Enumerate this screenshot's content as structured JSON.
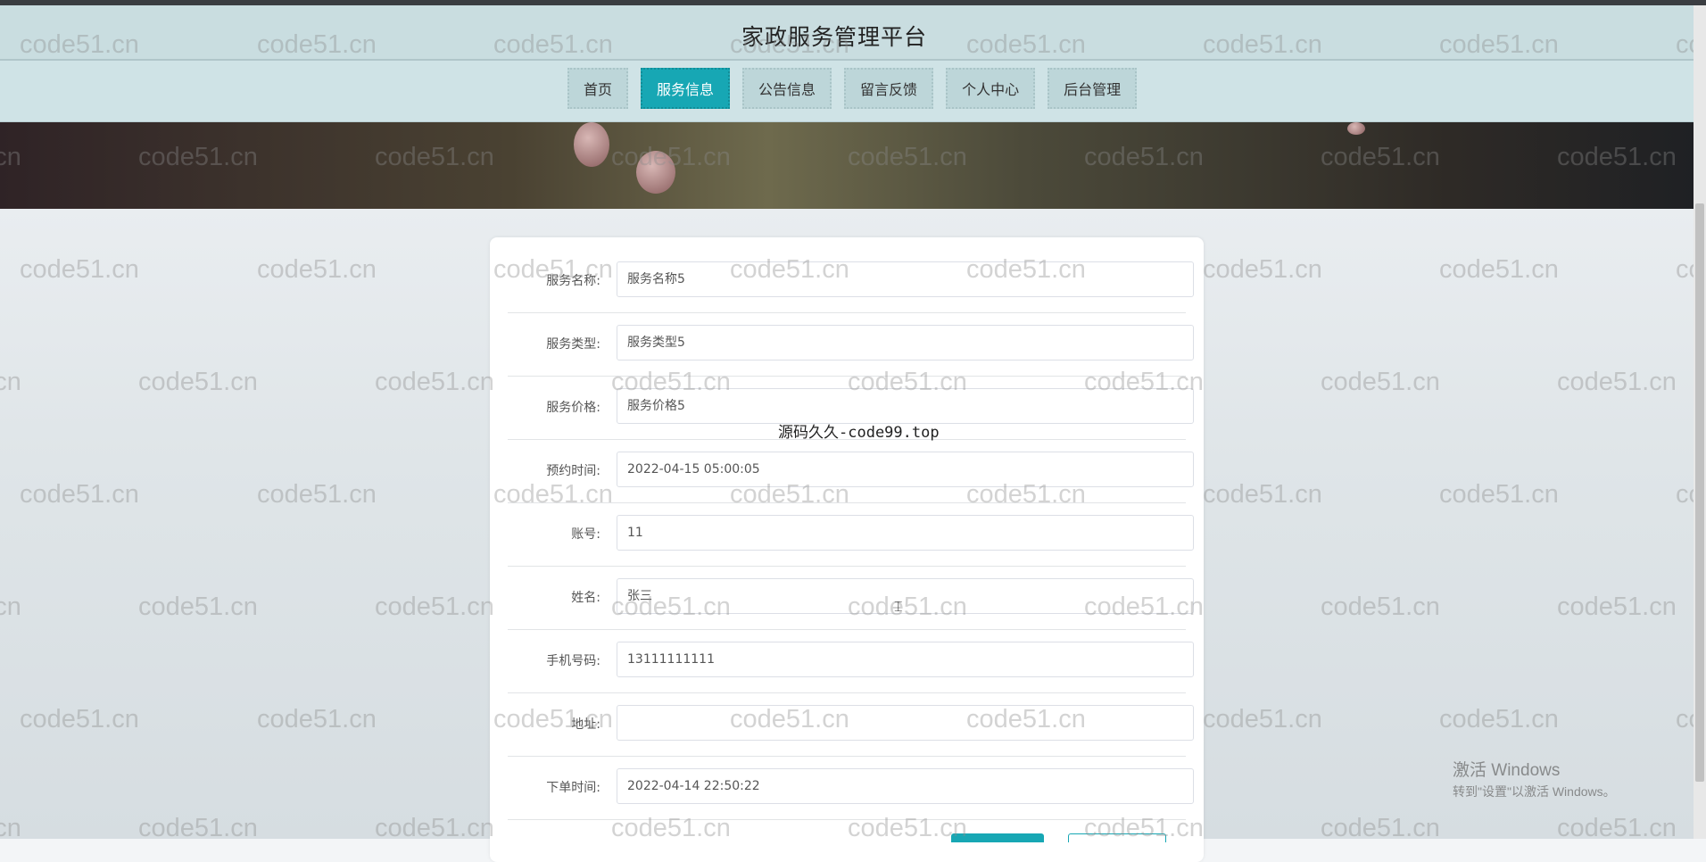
{
  "header": {
    "site_title": "家政服务管理平台"
  },
  "nav": {
    "items": [
      {
        "label": "首页",
        "active": false
      },
      {
        "label": "服务信息",
        "active": true
      },
      {
        "label": "公告信息",
        "active": false
      },
      {
        "label": "留言反馈",
        "active": false
      },
      {
        "label": "个人中心",
        "active": false
      },
      {
        "label": "后台管理",
        "active": false
      }
    ]
  },
  "form": {
    "fields": [
      {
        "label": "服务名称:",
        "value": "服务名称5"
      },
      {
        "label": "服务类型:",
        "value": "服务类型5"
      },
      {
        "label": "服务价格:",
        "value": "服务价格5"
      },
      {
        "label": "预约时间:",
        "value": "2022-04-15 05:00:05"
      },
      {
        "label": "账号:",
        "value": "11"
      },
      {
        "label": "姓名:",
        "value": "张三"
      },
      {
        "label": "手机号码:",
        "value": "13111111111"
      },
      {
        "label": "地址:",
        "value": ""
      },
      {
        "label": "下单时间:",
        "value": "2022-04-14 22:50:22"
      }
    ]
  },
  "overlay_text": "源码久久-code99.top",
  "watermark_text": "code51.cn",
  "windows_activation": {
    "line1": "激活 Windows",
    "line2": "转到\"设置\"以激活 Windows。"
  },
  "colors": {
    "accent": "#17a7b4",
    "header_bg": "#cfe3e6"
  }
}
